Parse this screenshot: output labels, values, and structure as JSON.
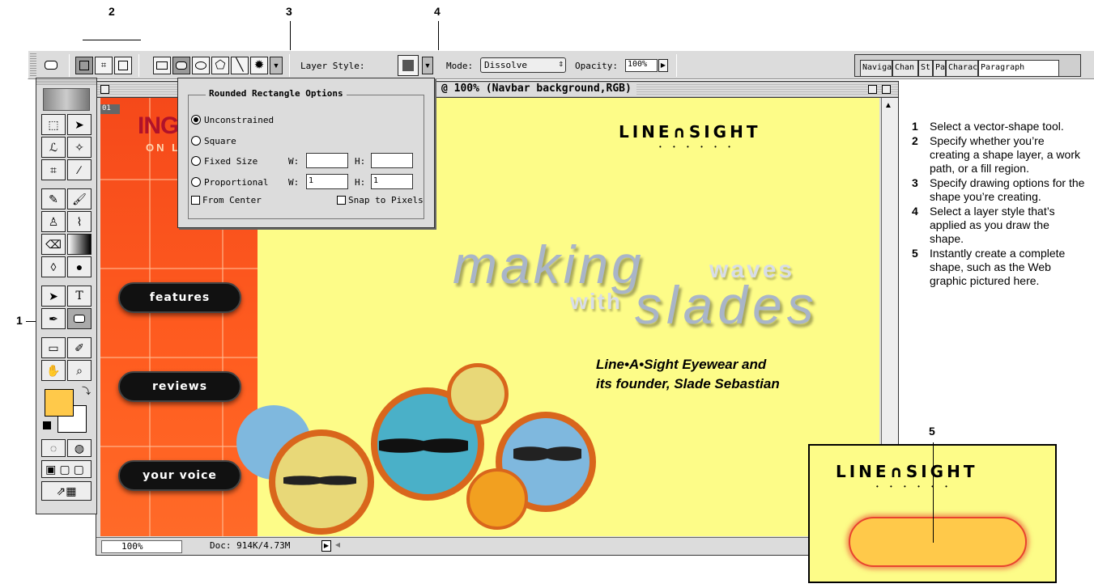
{
  "callouts": {
    "c1": "1",
    "c2": "2",
    "c3": "3",
    "c4": "4",
    "c5": "5"
  },
  "options_bar": {
    "layer_style_label": "Layer Style:",
    "mode_label": "Mode:",
    "mode_value": "Dissolve",
    "opacity_label": "Opacity:",
    "opacity_value": "100%"
  },
  "palette_tabs": [
    "Naviga",
    "Chan",
    "St",
    "Pa",
    "Charac",
    "Paragraph"
  ],
  "document": {
    "title": "@ 100% (Navbar background,RGB)",
    "zoom": "100%",
    "doc_size": "Doc: 914K/4.73M",
    "badge": "01"
  },
  "popup": {
    "title": "Rounded Rectangle Options",
    "unconstrained": "Unconstrained",
    "square": "Square",
    "fixed_size": "Fixed Size",
    "proportional": "Proportional",
    "w_label": "W:",
    "h_label": "H:",
    "prop_w": "1",
    "prop_h": "1",
    "from_center": "From Center",
    "snap": "Snap to Pixels"
  },
  "canvas": {
    "logo_partial": "ING",
    "logo_sub": "ON L",
    "brand": "LINE∩SIGHT",
    "brand_dots": "• • • • • •",
    "headline_1": "making",
    "headline_2": "waves",
    "headline_3": "with",
    "headline_4": "slades",
    "caption_1": "Line•A•Sight Eyewear and",
    "caption_2": "its founder, Slade Sebastian",
    "nav": [
      "features",
      "reviews",
      "your voice"
    ]
  },
  "notes": [
    {
      "n": "1",
      "text": "Select a vector-shape tool."
    },
    {
      "n": "2",
      "text": "Specify whether you’re creating a shape layer, a work path, or a fill region."
    },
    {
      "n": "3",
      "text": "Specify drawing options for the shape you’re creating."
    },
    {
      "n": "4",
      "text": "Select a layer style that’s applied as you draw the shape."
    },
    {
      "n": "5",
      "text": "Instantly create a complete shape, such as the Web graphic pictured here."
    }
  ],
  "inset": {
    "brand": "LINE∩SIGHT",
    "brand_dots": "• • • • • •"
  },
  "colors": {
    "canvas_bg": "#fdfc88",
    "orange": "#f5491a",
    "foreground_swatch": "#ffc94a",
    "shape_fill": "#ffc94a"
  }
}
